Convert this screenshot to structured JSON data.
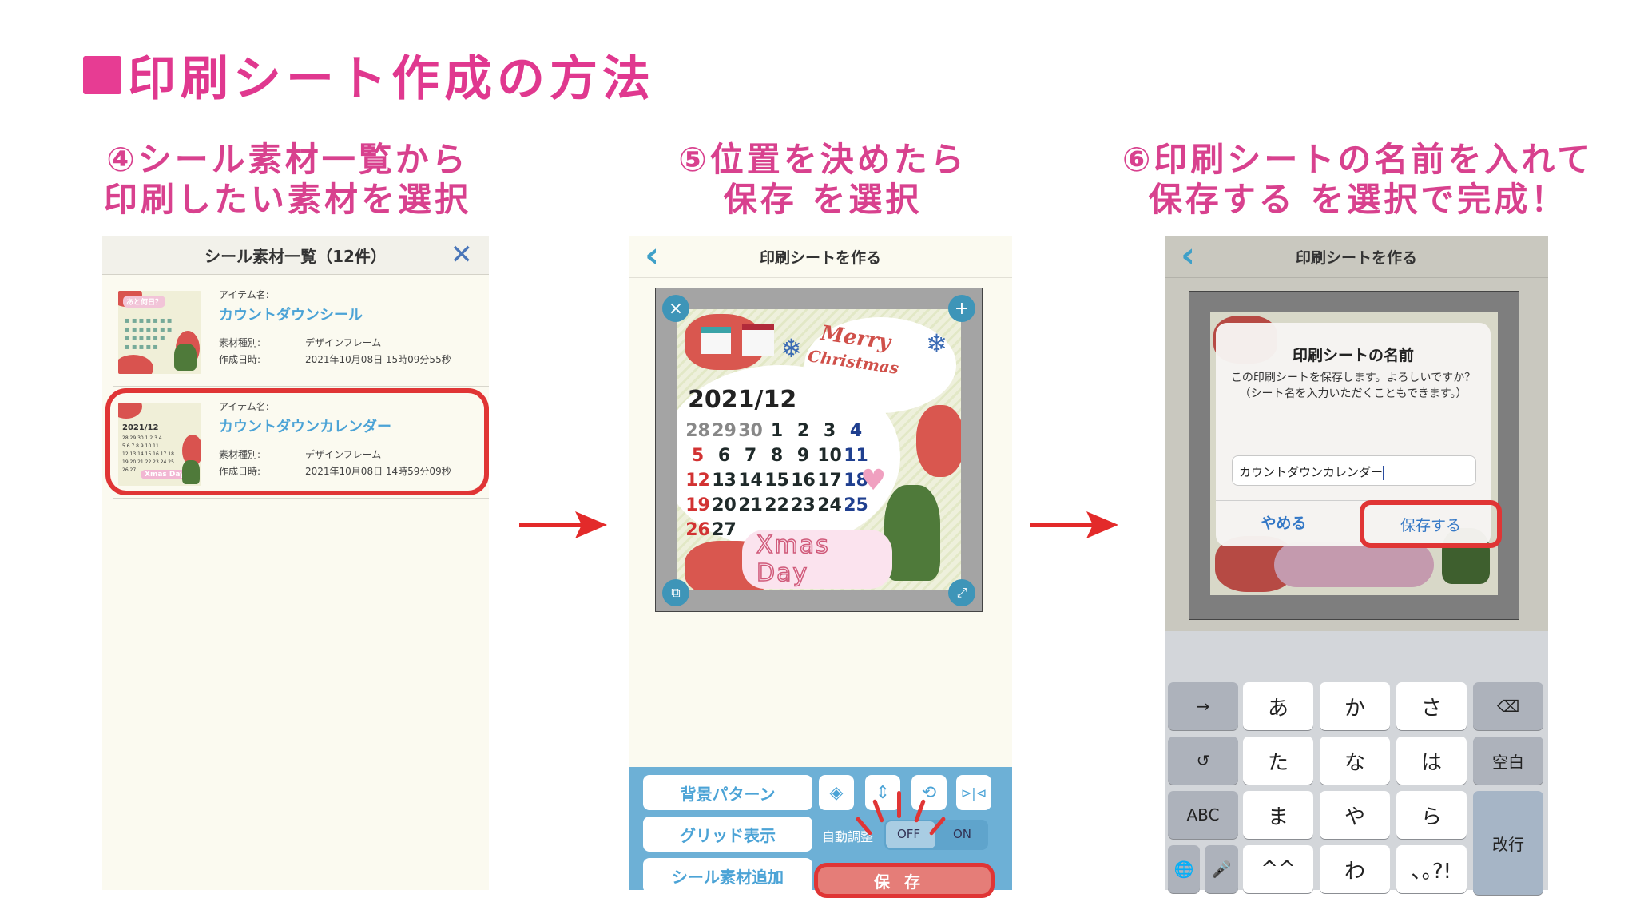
{
  "page": {
    "title": "印刷シート作成の方法",
    "accent_color": "#e0388f"
  },
  "steps": [
    {
      "line1": "④シール素材一覧から",
      "line2": "印刷したい素材を選択"
    },
    {
      "line1": "⑤位置を決めたら",
      "line2": "保存 を選択"
    },
    {
      "line1": "⑥印刷シートの名前を入れて",
      "line2": "保存する を選択で完成！"
    }
  ],
  "arrows": [
    "right-arrow-icon",
    "right-arrow-icon"
  ],
  "panel1": {
    "header": "シール素材一覧（12件）",
    "close_icon": "close-icon",
    "items": [
      {
        "name_label": "アイテム名:",
        "name": "カウントダウンシール",
        "type_label": "素材種別:",
        "type": "デザインフレーム",
        "date_label": "作成日時:",
        "date": "2021年10月08日 15時09分55秒",
        "thumb_text": "あと何日？",
        "highlighted": false
      },
      {
        "name_label": "アイテム名:",
        "name": "カウントダウンカレンダー",
        "type_label": "素材種別:",
        "type": "デザインフレーム",
        "date_label": "作成日時:",
        "date": "2021年10月08日 14時59分09秒",
        "thumb_text": "2021/12",
        "thumb_badge": "Xmas Day",
        "highlighted": true
      }
    ]
  },
  "panel2": {
    "header": "印刷シートを作る",
    "back_icon": "chevron-left-icon",
    "sheet": {
      "merry": "Merry",
      "christmas": "Christmas",
      "year_month": "2021/12",
      "weeks": [
        [
          "28",
          "29",
          "30",
          "1",
          "2",
          "3",
          "4"
        ],
        [
          "5",
          "6",
          "7",
          "8",
          "9",
          "10",
          "11"
        ],
        [
          "12",
          "13",
          "14",
          "15",
          "16",
          "17",
          "18"
        ],
        [
          "19",
          "20",
          "21",
          "22",
          "23",
          "24",
          "25"
        ],
        [
          "26",
          "27",
          "",
          "",
          "",
          "",
          ""
        ]
      ],
      "badge": "Xmas Day"
    },
    "handles": {
      "top_left": "×",
      "top_right": "+",
      "bottom_left": "⧉",
      "bottom_right": "⤢"
    },
    "toolbar": {
      "background_pattern": "背景パターン",
      "grid_display": "グリッド表示",
      "add_sticker": "シール素材追加",
      "auto_adjust": "自動調整",
      "off": "OFF",
      "on": "ON",
      "save": "保存",
      "icons": [
        "paint-bucket-icon",
        "resize-icon",
        "rotate-icon",
        "flip-icon"
      ],
      "icon_glyphs": [
        "◈",
        "⇕",
        "⟲",
        "⊳|⊲"
      ]
    }
  },
  "panel3": {
    "header": "印刷シートを作る",
    "back_icon": "chevron-left-icon",
    "dialog": {
      "title": "印刷シートの名前",
      "message": "この印刷シートを保存します。よろしいですか？\n（シート名を入力いただくこともできます。）",
      "input_value": "カウントダウンカレンダー",
      "cancel": "やめる",
      "save": "保存する"
    },
    "keyboard": {
      "rows": [
        [
          "→",
          "あ",
          "か",
          "さ",
          "⌫"
        ],
        [
          "↺",
          "た",
          "な",
          "は",
          "空白"
        ],
        [
          "ABC",
          "ま",
          "や",
          "ら",
          "改行"
        ],
        [
          "🌐",
          "🎤",
          "^^",
          "わ",
          "､｡?!"
        ]
      ]
    }
  }
}
